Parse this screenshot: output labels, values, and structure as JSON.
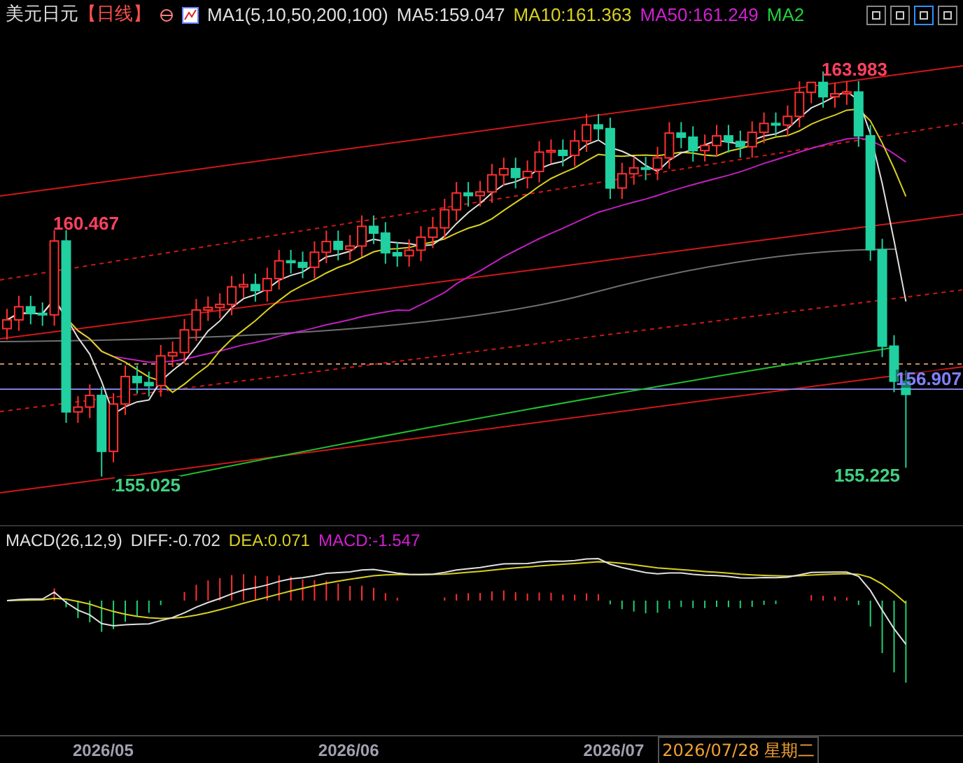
{
  "header": {
    "symbol": "美元日元",
    "period": "【日线】",
    "indicator": "MA1(5,10,50,200,100)",
    "ma_values": [
      {
        "label": "MA5:159.047",
        "color": "#e0e0e0"
      },
      {
        "label": "MA10:161.363",
        "color": "#d8d020"
      },
      {
        "label": "MA50:161.249",
        "color": "#d020d0"
      },
      {
        "label": "MA2",
        "color": "#20d040"
      }
    ]
  },
  "price_labels": [
    {
      "kind": "high",
      "text": "160.467"
    },
    {
      "kind": "low",
      "text": "155.025"
    },
    {
      "kind": "high",
      "text": "163.983"
    },
    {
      "kind": "low",
      "text": "155.225"
    },
    {
      "kind": "current",
      "text": "156.907"
    }
  ],
  "macd": {
    "title": "MACD(26,12,9)",
    "values": [
      {
        "label": "DIFF:-0.702",
        "color": "#e0e0e0"
      },
      {
        "label": "DEA:0.071",
        "color": "#d8d020"
      },
      {
        "label": "MACD:-1.547",
        "color": "#d020d0"
      }
    ]
  },
  "x_axis": {
    "labels": [
      "2026/05",
      "2026/06",
      "2026/07"
    ],
    "cursor_date": "2026/07/28 星期二"
  }
}
